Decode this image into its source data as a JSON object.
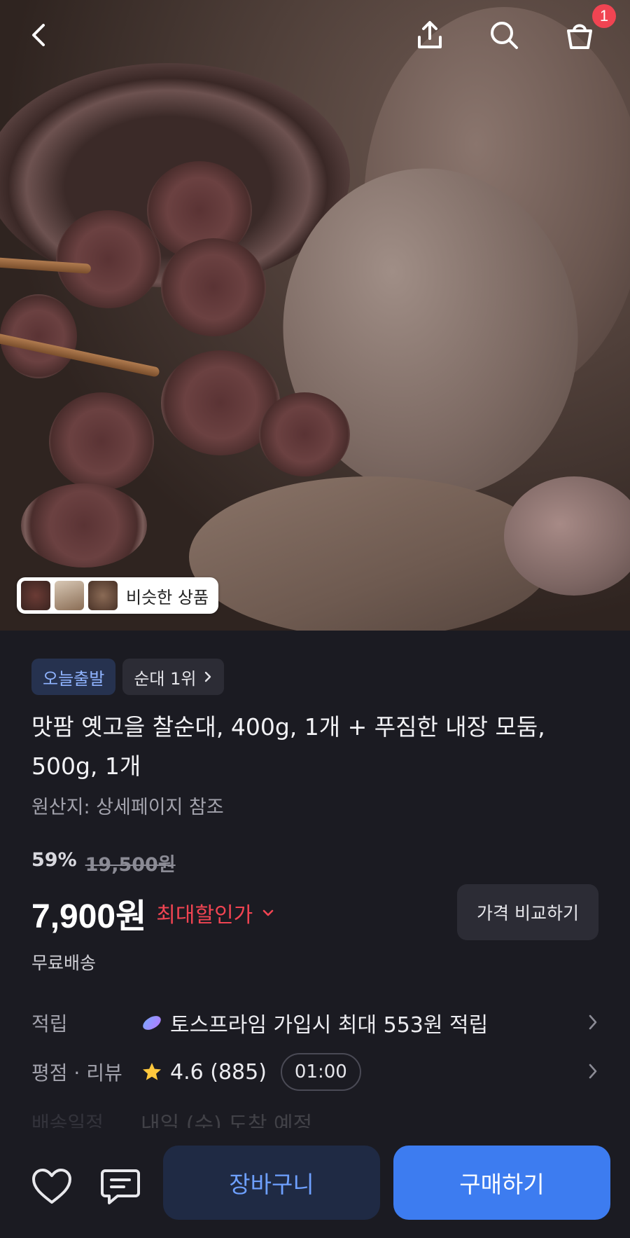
{
  "header": {
    "cart_badge": "1"
  },
  "hero": {
    "similar_products_label": "비슷한 상품"
  },
  "product": {
    "badges": [
      "오늘출발",
      "순대 1위"
    ],
    "title": "맛팜 옛고을 찰순대, 400g, 1개 + 푸짐한 내장 모둠, 500g, 1개",
    "origin": "원산지: 상세페이지 참조",
    "discount": "59%",
    "original_price": "19,500원",
    "price": "7,900원",
    "price_tag": "최대할인가",
    "compare_button": "가격 비교하기",
    "shipping": "무료배송"
  },
  "info": {
    "points_key": "적립",
    "points_value": "토스프라임 가입시 최대 553원 적립",
    "rating_key": "평점 · 리뷰",
    "rating_value": "4.6 (885)",
    "timer": "01:00",
    "delivery_key": "배송일정",
    "delivery_value": "내일 (수) 도착 예정"
  },
  "bottom": {
    "cart_button": "장바구니",
    "buy_button": "구매하기"
  },
  "colors": {
    "accent_blue": "#3d7cf0",
    "sale_red": "#f04452",
    "background": "#1b1b22"
  },
  "icons": [
    "back-icon",
    "share-icon",
    "search-icon",
    "shopping-bag-icon",
    "heart-icon",
    "chat-icon",
    "star-icon",
    "sparkle-icon",
    "chevron-right-icon",
    "chevron-down-icon"
  ]
}
